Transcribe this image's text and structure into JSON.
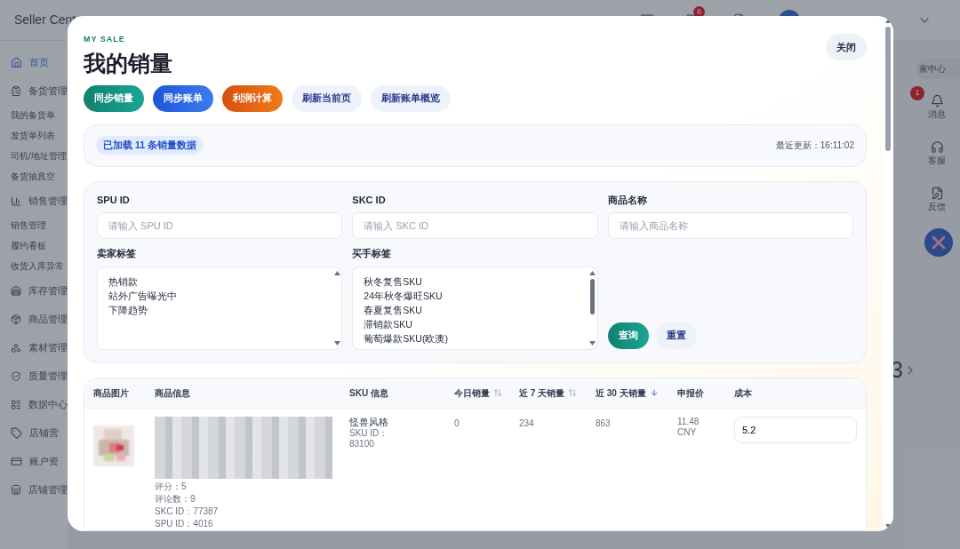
{
  "background": {
    "brand": "Seller Cent",
    "header_badge": "6",
    "sidebar": [
      {
        "label": "首页",
        "kind": "section",
        "selected": true
      },
      {
        "label": "备货管理",
        "kind": "section",
        "selected": false
      },
      {
        "label": "我的备货单",
        "kind": "item",
        "selected": false
      },
      {
        "label": "发货单列表",
        "kind": "item",
        "selected": false
      },
      {
        "label": "司机/地址管理",
        "kind": "item",
        "selected": false
      },
      {
        "label": "备货抽真空",
        "kind": "item",
        "selected": false
      },
      {
        "label": "销售管理",
        "kind": "section",
        "selected": false
      },
      {
        "label": "销售管理",
        "kind": "item",
        "selected": false
      },
      {
        "label": "履约看板",
        "kind": "item",
        "selected": false
      },
      {
        "label": "收货入库异常",
        "kind": "item",
        "selected": false
      },
      {
        "label": "库存管理",
        "kind": "section",
        "selected": false
      },
      {
        "label": "商品管理",
        "kind": "section",
        "selected": false
      },
      {
        "label": "素材管理",
        "kind": "section",
        "selected": false
      },
      {
        "label": "质量管理",
        "kind": "section",
        "selected": false
      },
      {
        "label": "数据中心",
        "kind": "section",
        "selected": false
      },
      {
        "label": "店铺营",
        "kind": "section",
        "selected": false
      },
      {
        "label": "账户资",
        "kind": "section",
        "selected": false
      },
      {
        "label": "店铺管理",
        "kind": "section",
        "selected": false
      }
    ],
    "merchant_link": "家中心",
    "side_tools": [
      {
        "label": "消息",
        "badge": "1"
      },
      {
        "label": "客服"
      },
      {
        "label": "反馈"
      }
    ],
    "page_digit": "3"
  },
  "modal": {
    "eyebrow": "MY SALE",
    "title": "我的销量",
    "close": "关闭",
    "actions": [
      {
        "label": "同步销量",
        "kind": "teal"
      },
      {
        "label": "同步账单",
        "kind": "blue"
      },
      {
        "label": "利润计算",
        "kind": "orange"
      },
      {
        "label": "刷新当前页",
        "kind": "soft"
      },
      {
        "label": "刷新账单概览",
        "kind": "soft"
      }
    ],
    "status": {
      "loaded": "已加载 11 条销量数据",
      "updated": "最近更新：16:11:02"
    },
    "filters": {
      "spu": {
        "label": "SPU ID",
        "placeholder": "请输入 SPU ID"
      },
      "skc": {
        "label": "SKC ID",
        "placeholder": "请输入 SKC ID"
      },
      "name": {
        "label": "商品名称",
        "placeholder": "请输入商品名称"
      },
      "seller_tags": {
        "label": "卖家标签",
        "options": [
          "热销款",
          "站外广告曝光中",
          "下降趋势"
        ]
      },
      "buyer_tags": {
        "label": "买手标签",
        "options": [
          "秋冬复售SKU",
          "24年秋冬爆旺SKU",
          "春夏复售SKU",
          "滞销款SKU",
          "葡萄爆款SKU(欧澳)"
        ]
      },
      "query": "查询",
      "reset": "重置"
    },
    "table": {
      "columns": [
        {
          "label": "商品图片",
          "sortable": false,
          "sorted_desc": false
        },
        {
          "label": "商品信息",
          "sortable": false,
          "sorted_desc": false
        },
        {
          "label": "SKU 信息",
          "sortable": false,
          "sorted_desc": false
        },
        {
          "label": "今日销量",
          "sortable": true,
          "sorted_desc": false
        },
        {
          "label": "近 7 天销量",
          "sortable": true,
          "sorted_desc": false
        },
        {
          "label": "近 30 天销量",
          "sortable": true,
          "sorted_desc": true
        },
        {
          "label": "申报价",
          "sortable": false,
          "sorted_desc": false
        },
        {
          "label": "成本",
          "sortable": false,
          "sorted_desc": false
        }
      ],
      "rows": [
        {
          "rating": "评分：5",
          "reviews": "评论数：9",
          "skc": "SKC ID：77387",
          "spu": "SPU ID：4016",
          "sku_style": "怪兽风格",
          "sku_label": "SKU ID：",
          "sku_id": "83100",
          "today": "0",
          "week": "234",
          "month": "863",
          "price": "11.48",
          "currency": "CNY",
          "cost": "5.2"
        }
      ]
    }
  }
}
